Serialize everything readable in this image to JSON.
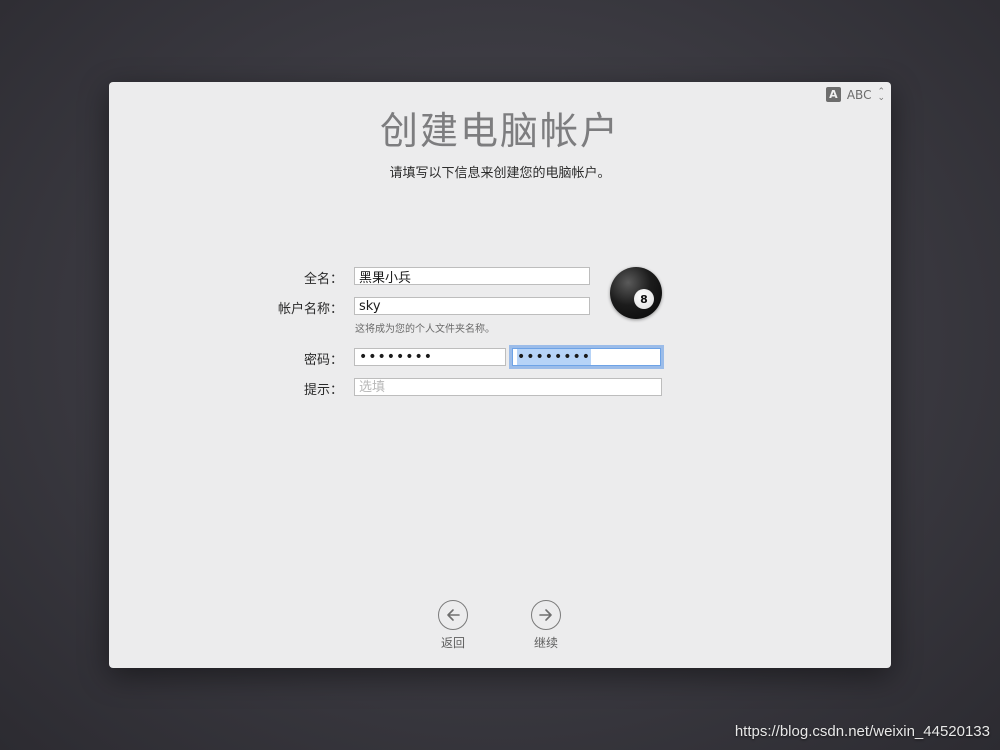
{
  "input_menu": {
    "badge": "A",
    "source": "ABC",
    "updown_icon": "chevron-updown-icon"
  },
  "title": "创建电脑帐户",
  "subtitle": "请填写以下信息来创建您的电脑帐户。",
  "form": {
    "full_name": {
      "label": "全名：",
      "value": "黑果小兵"
    },
    "account_name": {
      "label": "帐户名称：",
      "value": "sky",
      "hint": "这将成为您的个人文件夹名称。"
    },
    "password": {
      "label": "密码：",
      "value": "••••••••",
      "verify_value": "••••••••"
    },
    "hint": {
      "label": "提示：",
      "placeholder": "选填",
      "value": ""
    }
  },
  "avatar": {
    "icon": "eight-ball-icon",
    "number": "8"
  },
  "nav": {
    "back_label": "返回",
    "continue_label": "继续"
  },
  "watermark": "https://blog.csdn.net/weixin_44520133"
}
